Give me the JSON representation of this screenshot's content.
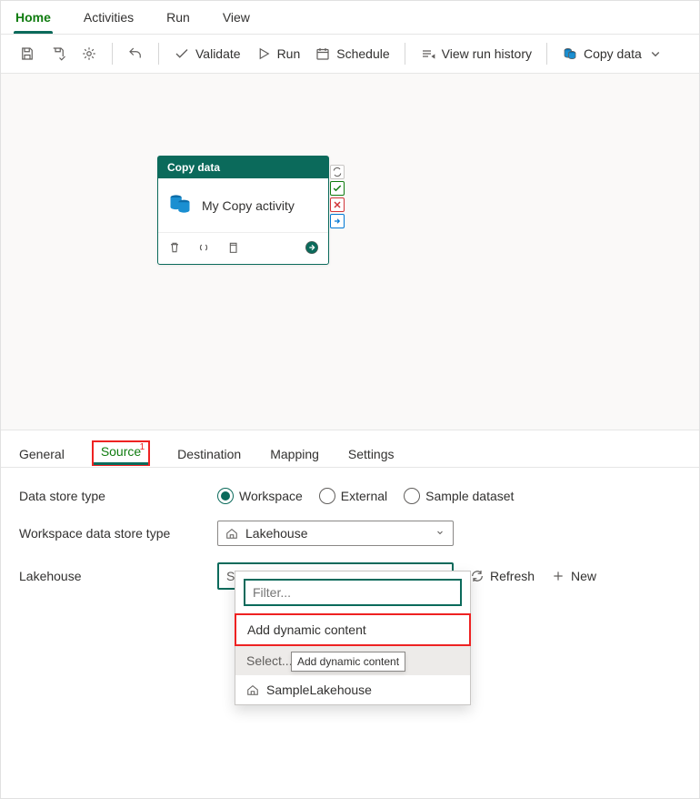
{
  "menu": {
    "tabs": [
      "Home",
      "Activities",
      "Run",
      "View"
    ],
    "active": 0
  },
  "toolbar": {
    "validate": "Validate",
    "run": "Run",
    "schedule": "Schedule",
    "viewHistory": "View run history",
    "copyData": "Copy data"
  },
  "activity": {
    "header": "Copy data",
    "title": "My Copy activity"
  },
  "propTabs": {
    "items": [
      "General",
      "Source",
      "Destination",
      "Mapping",
      "Settings"
    ],
    "active": 1,
    "badge": "1"
  },
  "form": {
    "dataStoreTypeLabel": "Data store type",
    "radios": {
      "workspace": "Workspace",
      "external": "External",
      "sample": "Sample dataset"
    },
    "wsTypeLabel": "Workspace data store type",
    "wsTypeValue": "Lakehouse",
    "lakehouseLabel": "Lakehouse",
    "lakehousePlaceholder": "Select...",
    "refresh": "Refresh",
    "new": "New"
  },
  "dropdown": {
    "filterPlaceholder": "Filter...",
    "addDynamic": "Add dynamic content",
    "selectHdr": "Select...",
    "option1": "SampleLakehouse",
    "tooltip": "Add dynamic content"
  }
}
